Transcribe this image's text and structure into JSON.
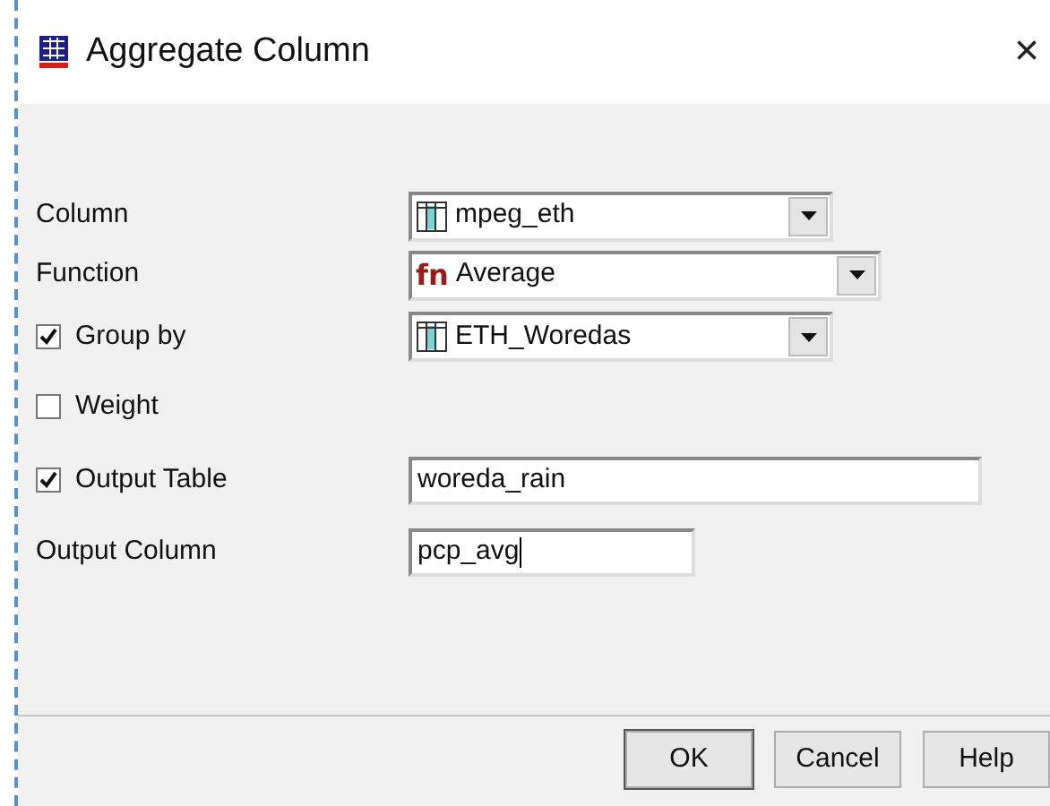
{
  "window": {
    "title": "Aggregate Column",
    "close": "×"
  },
  "rows": [
    {
      "kind": "label",
      "label": "Column",
      "control": {
        "kind": "table_combo",
        "value": "mpeg_eth"
      }
    },
    {
      "kind": "label",
      "label": "Function",
      "control": {
        "kind": "function_combo",
        "icon_text": "fn",
        "value": "Average"
      }
    },
    {
      "kind": "checkbox",
      "label": "Group by",
      "checked": true,
      "control": {
        "kind": "table_combo",
        "value": "ETH_Woredas"
      }
    },
    {
      "kind": "checkbox",
      "label": "Weight",
      "checked": false
    },
    {
      "kind": "checkbox",
      "label": "Output Table",
      "checked": true,
      "control": {
        "kind": "text",
        "value": "woreda_rain"
      }
    },
    {
      "kind": "label",
      "label": "Output Column",
      "control": {
        "kind": "text",
        "value": "pcp_avg",
        "focused": true
      }
    }
  ],
  "buttons": [
    "OK",
    "Cancel",
    "Help"
  ]
}
